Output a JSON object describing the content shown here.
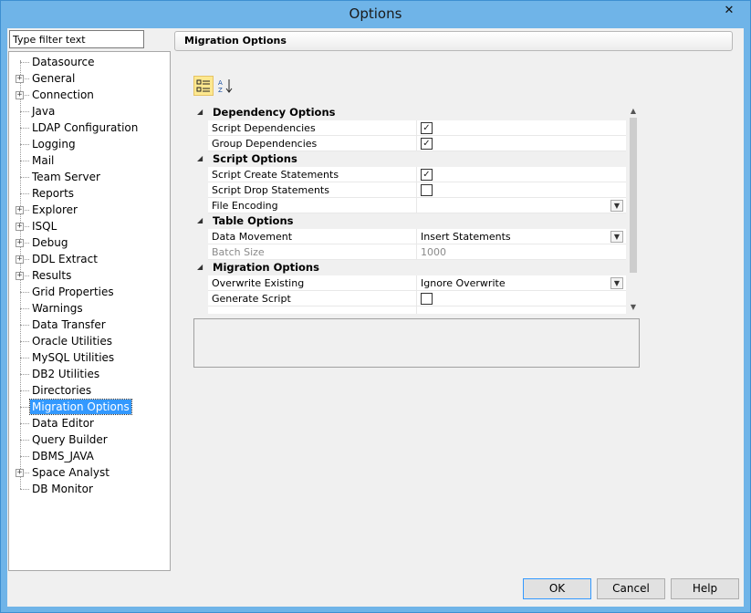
{
  "window": {
    "title": "Options",
    "close_glyph": "✕"
  },
  "filter": {
    "placeholder": "Type filter text",
    "value": "Type filter text"
  },
  "tree": {
    "items": [
      {
        "label": "Datasource",
        "expandable": false
      },
      {
        "label": "General",
        "expandable": true
      },
      {
        "label": "Connection",
        "expandable": true
      },
      {
        "label": "Java",
        "expandable": false
      },
      {
        "label": "LDAP Configuration",
        "expandable": false
      },
      {
        "label": "Logging",
        "expandable": false
      },
      {
        "label": "Mail",
        "expandable": false
      },
      {
        "label": "Team Server",
        "expandable": false
      },
      {
        "label": "Reports",
        "expandable": false
      },
      {
        "label": "Explorer",
        "expandable": true
      },
      {
        "label": "ISQL",
        "expandable": true
      },
      {
        "label": "Debug",
        "expandable": true
      },
      {
        "label": "DDL Extract",
        "expandable": true
      },
      {
        "label": "Results",
        "expandable": true
      },
      {
        "label": "Grid Properties",
        "expandable": false
      },
      {
        "label": "Warnings",
        "expandable": false
      },
      {
        "label": "Data Transfer",
        "expandable": false
      },
      {
        "label": "Oracle Utilities",
        "expandable": false
      },
      {
        "label": "MySQL Utilities",
        "expandable": false
      },
      {
        "label": "DB2 Utilities",
        "expandable": false
      },
      {
        "label": "Directories",
        "expandable": false
      },
      {
        "label": "Migration Options",
        "expandable": false,
        "selected": true
      },
      {
        "label": "Data Editor",
        "expandable": false
      },
      {
        "label": "Query Builder",
        "expandable": false
      },
      {
        "label": "DBMS_JAVA",
        "expandable": false
      },
      {
        "label": "Space Analyst",
        "expandable": true
      },
      {
        "label": "DB Monitor",
        "expandable": false
      }
    ]
  },
  "panel": {
    "header": "Migration Options"
  },
  "toolbar": {
    "categorized_icon": "categorized-icon",
    "alpha_icon": "sort-alpha-icon",
    "alpha_label": "A Z"
  },
  "grid": {
    "categories": [
      {
        "label": "Dependency Options",
        "rows": [
          {
            "name": "Script Dependencies",
            "type": "check",
            "checked": true
          },
          {
            "name": "Group Dependencies",
            "type": "check",
            "checked": true
          }
        ]
      },
      {
        "label": "Script Options",
        "rows": [
          {
            "name": "Script Create Statements",
            "type": "check",
            "checked": true
          },
          {
            "name": "Script Drop Statements",
            "type": "check",
            "checked": false
          },
          {
            "name": "File Encoding",
            "type": "dropdown",
            "value": ""
          }
        ]
      },
      {
        "label": "Table Options",
        "rows": [
          {
            "name": "Data Movement",
            "type": "dropdown",
            "value": "Insert Statements"
          },
          {
            "name": "Batch Size",
            "type": "text",
            "value": "1000",
            "disabled": true
          }
        ]
      },
      {
        "label": "Migration Options",
        "rows": [
          {
            "name": "Overwrite Existing",
            "type": "dropdown",
            "value": "Ignore Overwrite"
          },
          {
            "name": "Generate Script",
            "type": "check",
            "checked": false
          }
        ]
      }
    ]
  },
  "buttons": {
    "ok": "OK",
    "cancel": "Cancel",
    "help": "Help"
  }
}
